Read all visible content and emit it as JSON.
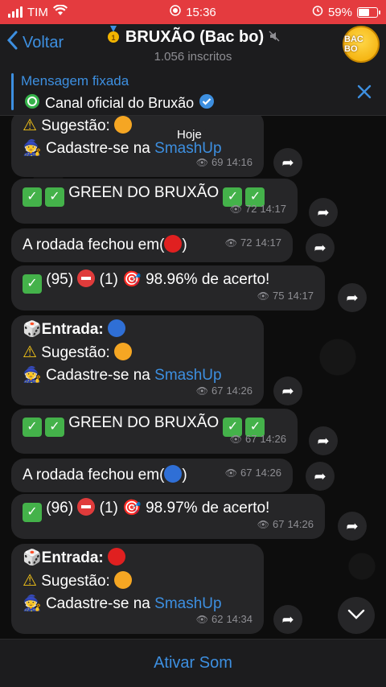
{
  "status_bar": {
    "carrier": "TIM",
    "time": "15:36",
    "battery": "59%"
  },
  "header": {
    "back_label": "Voltar",
    "title": "BRUXÃO (Bac bo)",
    "subscribers": "1.056 inscritos",
    "avatar_text": "BAC BO"
  },
  "pinned": {
    "title": "Mensagem fixada",
    "text": "Canal oficial do Bruxão"
  },
  "chat": {
    "date_chip": "Hoje",
    "messages": [
      {
        "lines": [
          "Sugestão:",
          "Cadastre-se na"
        ],
        "link": "SmashUp",
        "views": "69",
        "time": "14:16"
      },
      {
        "text": "GREEN DO BRUXÃO",
        "views": "72",
        "time": "14:17"
      },
      {
        "text": "A rodada fechou em(",
        "close": ")",
        "views": "72",
        "time": "14:17"
      },
      {
        "wins": "(95)",
        "losses": "(1)",
        "accuracy": "98.96% de acerto!",
        "views": "75",
        "time": "14:17"
      },
      {
        "entry": "Entrada:",
        "suggestion": "Sugestão:",
        "register": "Cadastre-se na",
        "link": "SmashUp",
        "views": "67",
        "time": "14:26"
      },
      {
        "text": "GREEN DO BRUXÃO",
        "views": "67",
        "time": "14:26"
      },
      {
        "text": "A rodada fechou em(",
        "close": ")",
        "views": "67",
        "time": "14:26"
      },
      {
        "wins": "(96)",
        "losses": "(1)",
        "accuracy": "98.97% de acerto!",
        "views": "67",
        "time": "14:26"
      },
      {
        "entry": "Entrada:",
        "suggestion": "Sugestão:",
        "register": "Cadastre-se na",
        "link": "SmashUp",
        "views": "62",
        "time": "14:34"
      }
    ]
  },
  "bottom": {
    "unmute_label": "Ativar Som"
  },
  "colors": {
    "accent": "#3d8fe0",
    "status_bar": "#e43b3f",
    "bubble": "#262628"
  }
}
